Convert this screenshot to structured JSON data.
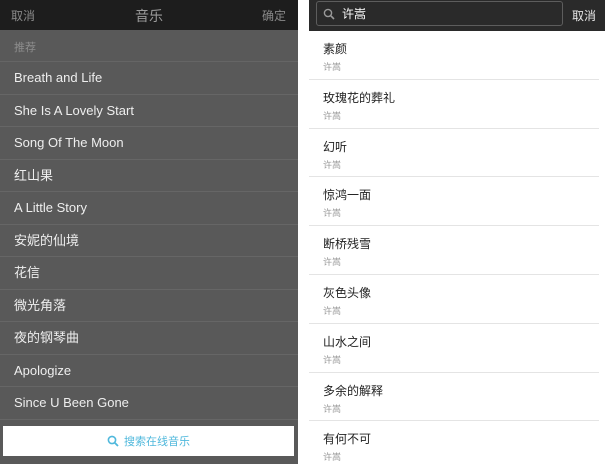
{
  "left": {
    "header": {
      "cancel": "取消",
      "title": "音乐",
      "confirm": "确定"
    },
    "section_label": "推荐",
    "items": [
      "Breath and Life",
      "She Is A Lovely Start",
      "Song Of The Moon",
      "红山果",
      "A Little Story",
      "安妮的仙境",
      "花信",
      "微光角落",
      "夜的钢琴曲",
      "Apologize",
      "Since U Been Gone"
    ],
    "search_online": "搜索在线音乐"
  },
  "right": {
    "search": {
      "query": "许嵩",
      "cancel": "取消"
    },
    "results": [
      {
        "song": "素颜",
        "artist": "许嵩"
      },
      {
        "song": "玫瑰花的葬礼",
        "artist": "许嵩"
      },
      {
        "song": "幻听",
        "artist": "许嵩"
      },
      {
        "song": "惊鸿一面",
        "artist": "许嵩"
      },
      {
        "song": "断桥残雪",
        "artist": "许嵩"
      },
      {
        "song": "灰色头像",
        "artist": "许嵩"
      },
      {
        "song": "山水之间",
        "artist": "许嵩"
      },
      {
        "song": "多余的解释",
        "artist": "许嵩"
      },
      {
        "song": "有何不可",
        "artist": "许嵩"
      }
    ]
  },
  "colors": {
    "accent": "#4fb8dc",
    "dark_header": "#1d1d1d",
    "overlay": "#595959"
  }
}
